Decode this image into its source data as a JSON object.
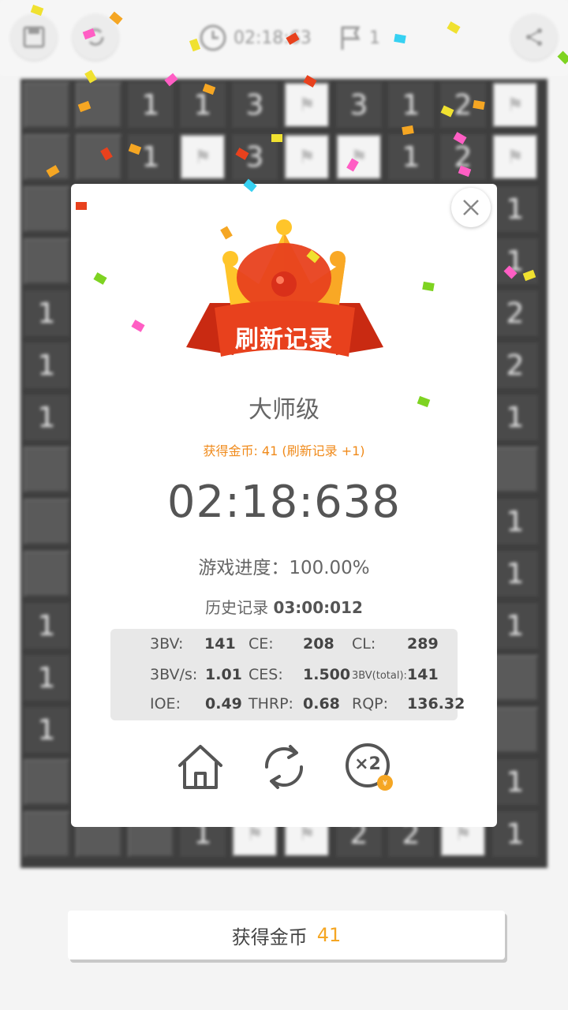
{
  "topbar": {
    "timer": "02:18:63",
    "flags": "1",
    "icons": [
      "save-icon",
      "restart-icon",
      "clock-icon",
      "flag-icon",
      "share-icon"
    ]
  },
  "board": {
    "rows": [
      [
        "",
        "",
        "1",
        "1",
        "3",
        "F",
        "3",
        "1",
        "2",
        "F"
      ],
      [
        "",
        "",
        "1",
        "F",
        "3",
        "F",
        "F",
        "1",
        "2",
        "F"
      ],
      [
        "",
        "",
        "",
        "",
        "",
        "",
        "",
        "",
        "",
        "1"
      ],
      [
        "",
        "",
        "",
        "",
        "",
        "",
        "",
        "",
        "",
        "1"
      ],
      [
        "1",
        "",
        "",
        "",
        "",
        "",
        "",
        "",
        "",
        "2"
      ],
      [
        "1",
        "",
        "",
        "",
        "",
        "",
        "",
        "",
        "",
        "2"
      ],
      [
        "1",
        "",
        "",
        "",
        "",
        "",
        "",
        "",
        "",
        "1"
      ],
      [
        "",
        "",
        "",
        "",
        "",
        "",
        "",
        "",
        "",
        ""
      ],
      [
        "",
        "",
        "",
        "",
        "",
        "",
        "",
        "",
        "",
        "1"
      ],
      [
        "",
        "",
        "",
        "",
        "",
        "",
        "",
        "",
        "",
        "1"
      ],
      [
        "1",
        "",
        "",
        "",
        "",
        "",
        "",
        "",
        "",
        "1"
      ],
      [
        "1",
        "",
        "",
        "",
        "",
        "",
        "",
        "",
        "",
        ""
      ],
      [
        "1",
        "",
        "",
        "",
        "",
        "",
        "",
        "",
        "",
        ""
      ],
      [
        "",
        "",
        "",
        "",
        "",
        "",
        "",
        "",
        "",
        "1"
      ],
      [
        "",
        "",
        "",
        "1",
        "F",
        "F",
        "2",
        "2",
        "F",
        "1"
      ]
    ]
  },
  "modal": {
    "badge": "刷新记录",
    "level": "大师级",
    "coins_earned": "获得金币: 41 (刷新记录 +1)",
    "time": "02:18:638",
    "progress": "游戏进度：100.00%",
    "history_label": "历史记录",
    "history_value": "03:00:012",
    "stats": [
      [
        {
          "label": "3BV:",
          "value": "141"
        },
        {
          "label": "CE:",
          "value": "208"
        },
        {
          "label": "CL:",
          "value": "289"
        }
      ],
      [
        {
          "label": "3BV/s:",
          "value": "1.01"
        },
        {
          "label": "CES:",
          "value": "1.500"
        },
        {
          "label": "3BV(total):",
          "value": "141"
        }
      ],
      [
        {
          "label": "IOE:",
          "value": "0.49"
        },
        {
          "label": "THRP:",
          "value": "0.68"
        },
        {
          "label": "RQP:",
          "value": "136.32"
        }
      ]
    ],
    "actions": [
      "home-icon",
      "restart-icon",
      "double-reward-icon"
    ],
    "double_label": "×2"
  },
  "coin_bar": {
    "label": "获得金币",
    "amount": "41"
  },
  "colors": {
    "accent_orange": "#f5a623",
    "ribbon_red": "#e8411d",
    "crown_yellow": "#ffc52a",
    "board_dark": "#3e3e3e"
  }
}
